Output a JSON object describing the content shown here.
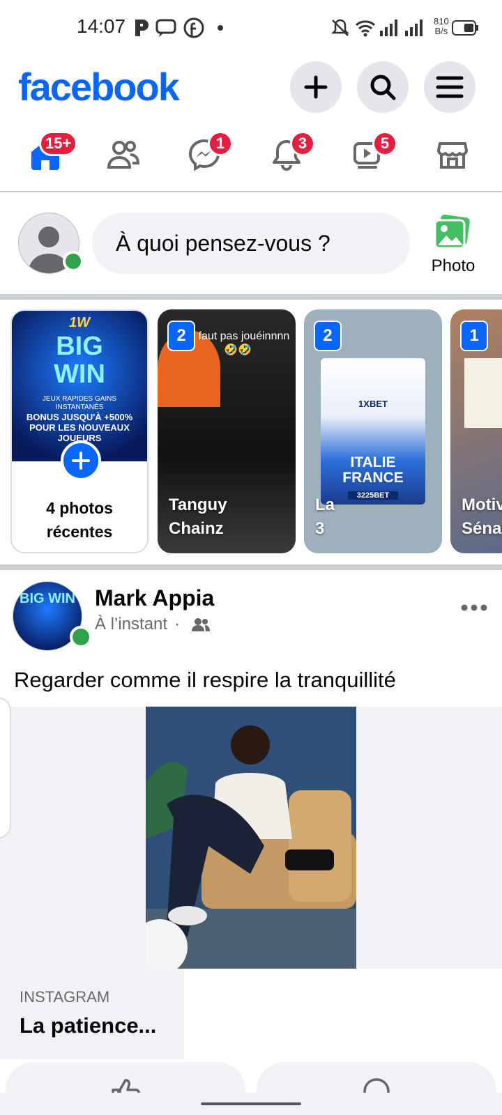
{
  "status_bar": {
    "time": "14:07",
    "net_speed_value": "810",
    "net_speed_unit": "B/s"
  },
  "header": {
    "logo": "facebook",
    "brand_color": "#0866ff"
  },
  "nav": {
    "home_badge": "15+",
    "messenger_badge": "1",
    "notifications_badge": "3",
    "video_badge": "5"
  },
  "composer": {
    "placeholder": "À quoi pensez-vous ?",
    "photo_label": "Photo"
  },
  "stories": [
    {
      "kind": "create",
      "label": "4 photos récentes",
      "img_text_1": "1W",
      "img_text_2": "BIG WIN",
      "img_text_3": "JEUX RAPIDES GAINS INSTANTANÉS",
      "img_text_4": "BONUS JUSQU'À +500% POUR LES NOUVEAUX JOUEURS"
    },
    {
      "count": "2",
      "name_line1": "Tanguy",
      "name_line2": "Chainz",
      "caption": "M faut pas jouéinnnn 🤣🤣"
    },
    {
      "count": "2",
      "name_line1": "La",
      "name_line2": "3",
      "img_text_1": "1XBET",
      "img_text_2": "ITALIE FRANCE",
      "img_text_3": "3225BET"
    },
    {
      "count": "1",
      "name_line1": "Motiv",
      "name_line2": "Sénac"
    }
  ],
  "post": {
    "author": "Mark Appia",
    "time": "À l’instant",
    "text": "Regarder comme il respire la tranquillité",
    "link_source": "INSTAGRAM",
    "link_title": "La patience..."
  },
  "colors": {
    "badge_red": "#e41e3f",
    "online_green": "#31a24c",
    "story_count_blue": "#0866ff"
  }
}
